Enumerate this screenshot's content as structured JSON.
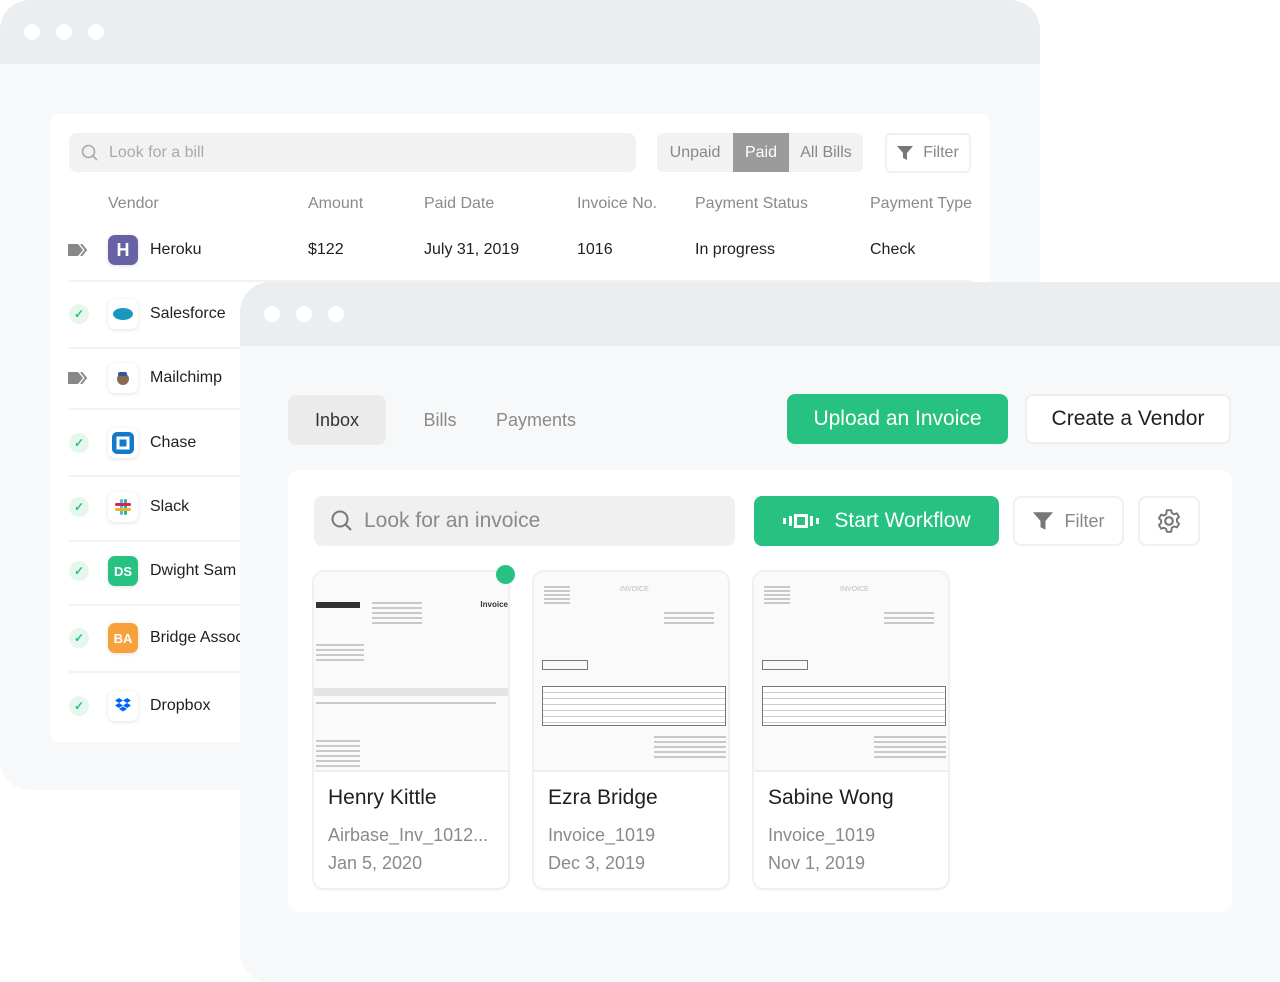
{
  "bills_window": {
    "search_placeholder": "Look for a bill",
    "segments": [
      "Unpaid",
      "Paid",
      "All Bills"
    ],
    "active_segment": "Paid",
    "filter_label": "Filter",
    "columns": [
      "Vendor",
      "Amount",
      "Paid Date",
      "Invoice No.",
      "Payment Status",
      "Payment Type"
    ],
    "rows": [
      {
        "status": "in-progress",
        "vendor": "Heroku",
        "logo": "H",
        "amount": "$122",
        "paid_date": "July 31, 2019",
        "invoice_no": "1016",
        "payment_status": "In progress",
        "payment_type": "Check"
      },
      {
        "status": "paid",
        "vendor": "Salesforce",
        "logo": "salesforce"
      },
      {
        "status": "in-progress",
        "vendor": "Mailchimp",
        "logo": "mailchimp"
      },
      {
        "status": "paid",
        "vendor": "Chase",
        "logo": "chase"
      },
      {
        "status": "paid",
        "vendor": "Slack",
        "logo": "slack"
      },
      {
        "status": "paid",
        "vendor": "Dwight Sam",
        "logo": "DS"
      },
      {
        "status": "paid",
        "vendor": "Bridge Associates",
        "logo": "BA"
      },
      {
        "status": "paid",
        "vendor": "Dropbox",
        "logo": "dropbox"
      }
    ]
  },
  "inbox_window": {
    "tabs": [
      "Inbox",
      "Bills",
      "Payments"
    ],
    "active_tab": "Inbox",
    "upload_label": "Upload an Invoice",
    "create_vendor_label": "Create a Vendor",
    "search_placeholder": "Look for an invoice",
    "workflow_label": "Start Workflow",
    "filter_label": "Filter",
    "invoices": [
      {
        "name": "Henry Kittle",
        "file": "Airbase_Inv_1012...",
        "date": "Jan 5, 2020",
        "unread": true,
        "doc_title": "Invoice"
      },
      {
        "name": "Ezra Bridge",
        "file": "Invoice_1019",
        "date": "Dec 3, 2019",
        "unread": false,
        "doc_title": "INVOICE"
      },
      {
        "name": "Sabine Wong",
        "file": "Invoice_1019",
        "date": "Nov 1, 2019",
        "unread": false,
        "doc_title": "INVOICE"
      }
    ]
  },
  "colors": {
    "accent": "#27c281",
    "heroku": "#6762a6",
    "salesforce": "#1798c1",
    "chase": "#117aca",
    "ds": "#27c281",
    "ba": "#f7a13b",
    "dropbox": "#0061ff"
  }
}
